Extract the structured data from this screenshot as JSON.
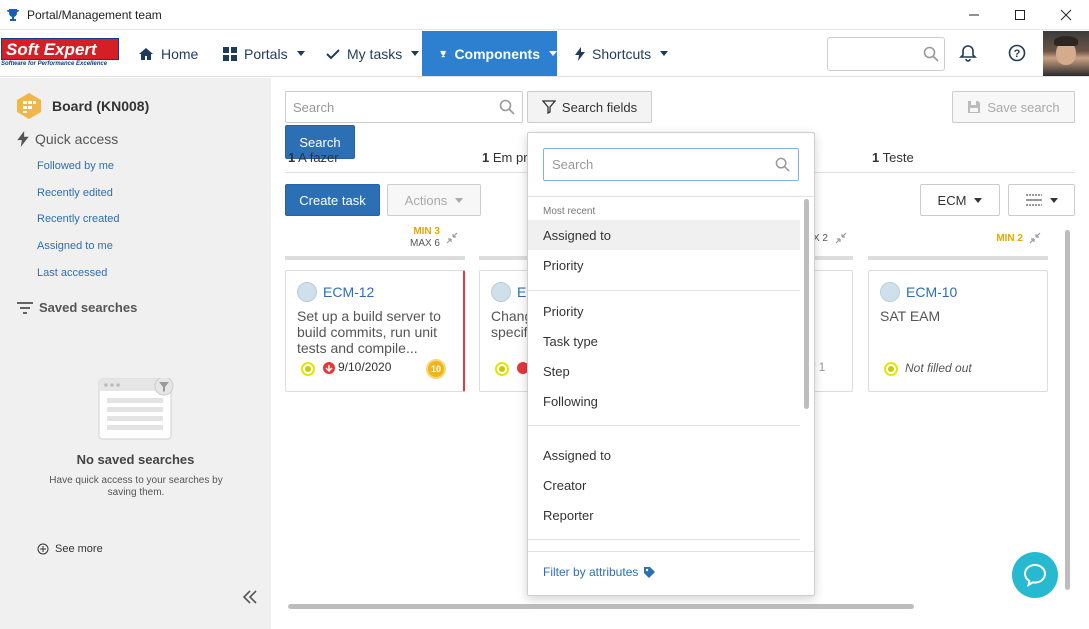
{
  "window": {
    "title": "Portal/Management team"
  },
  "logo": {
    "name": "Soft Expert",
    "tagline": "Software for Performance Excellence"
  },
  "nav": {
    "home": "Home",
    "portals": "Portals",
    "my_tasks": "My tasks",
    "components": "Components",
    "shortcuts": "Shortcuts"
  },
  "sidebar": {
    "board_title": "Board (KN008)",
    "quick_access": "Quick access",
    "links": [
      "Followed by me",
      "Recently edited",
      "Recently created",
      "Assigned to me",
      "Last accessed"
    ],
    "saved_searches": "Saved searches",
    "empty_title": "No saved searches",
    "empty_desc": "Have quick access to your searches by saving them.",
    "see_more": "See more"
  },
  "toolbar": {
    "search_placeholder": "Search",
    "search_fields": "Search fields",
    "save_search": "Save search",
    "search_button": "Search",
    "create_task": "Create task",
    "actions": "Actions",
    "ecm": "ECM"
  },
  "columns": [
    {
      "count": "1",
      "name": "A fazer",
      "min": "MIN 3",
      "max": "MAX 6"
    },
    {
      "count": "1",
      "name": "Em pr",
      "min": "",
      "max": "X 2"
    },
    {
      "count": "1",
      "name": "Teste",
      "min": "MIN 2",
      "max": ""
    }
  ],
  "cards": [
    {
      "id": "ECM-12",
      "text": "Set up a build server to build commits, run unit tests and compile...",
      "date": "9/10/2020",
      "badge": "10"
    },
    {
      "id": "E",
      "text": "Chang specif",
      "extra": "f 1"
    },
    {
      "id": "ECM-10",
      "text": "SAT EAM",
      "status": "Not filled out"
    }
  ],
  "dropdown": {
    "search_placeholder": "Search",
    "most_recent_label": "Most recent",
    "most_recent": [
      "Assigned to",
      "Priority"
    ],
    "group2": [
      "Priority",
      "Task type",
      "Step",
      "Following"
    ],
    "group3": [
      "Assigned to",
      "Creator",
      "Reporter"
    ],
    "filter_by_attributes": "Filter by attributes"
  },
  "colors": {
    "accent": "#2d7fcf",
    "primary_button": "#2d6fb5",
    "chat": "#27b9cf",
    "warning": "#e6a800"
  }
}
